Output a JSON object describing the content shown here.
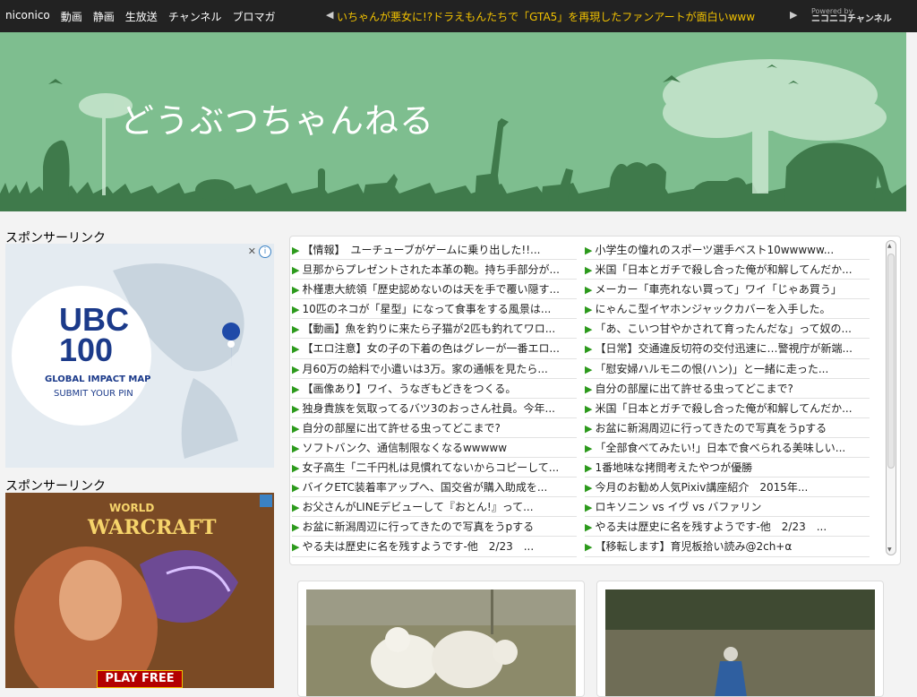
{
  "topbar": {
    "nav": [
      "niconico",
      "動画",
      "静画",
      "生放送",
      "チャンネル",
      "ブロマガ"
    ],
    "ticker": "いちゃんが悪女に!?ドラえもんたちで「GTA5」を再現したファンアートが面白いwww",
    "powered_small": "Powered by",
    "powered_brand": "ニコニコチャンネル"
  },
  "banner": {
    "title": "どうぶつちゃんねる"
  },
  "sidebar": {
    "sponsor_label_1": "スポンサーリンク",
    "sponsor_label_2": "スポンサーリンク",
    "ad1": {
      "big1": "UBC",
      "big2": "100",
      "line1": "GLOBAL IMPACT MAP",
      "line2": "SUBMIT YOUR PIN"
    },
    "ad2": {
      "line1": "WORLD",
      "line2": "WARCRAFT",
      "button": "PLAY FREE"
    }
  },
  "links": {
    "left": [
      "【情報】　ユーチューブがゲームに乗り出した!!...",
      "旦那からプレゼントされた本革の鞄。持ち手部分が...",
      "朴槿恵大統領「歴史認めないのは天を手で覆い隠す...",
      "10匹のネコが「星型」になって食事をする風景は...",
      "【動画】魚を釣りに来たら子猫が2匹も釣れてワロ...",
      "【エロ注意】女の子の下着の色はグレーが一番エロ...",
      "月60万の給料で小遣いは3万。家の通帳を見たら...",
      "【画像あり】ワイ、うなぎもどきをつくる。",
      "独身貴族を気取ってるバツ3のおっさん社員。今年...",
      "自分の部屋に出て許せる虫ってどこまで?",
      "ソフトバンク、通信制限なくなるwwwww",
      "女子高生「二千円札は見慣れてないからコピーして...",
      "バイクETC装着率アップへ、国交省が購入助成を...",
      "お父さんがLINEデビューして『おとん!』って...",
      "お盆に新潟周辺に行ってきたので写真をうpする",
      "やる夫は歴史に名を残すようです-他　2/23　..."
    ],
    "right": [
      "小学生の憧れのスポーツ選手ベスト10wwwww...",
      "米国「日本とガチで殺し合った俺が和解してんだか...",
      "メーカー「車売れない買って」ワイ「じゃあ買う」",
      "にゃんこ型イヤホンジャックカバーを入手した。",
      "「あ、こいつ甘やかされて育ったんだな」って奴の...",
      "【日常】交通違反切符の交付迅速に…警視庁が新端...",
      "「慰安婦ハルモニの恨(ハン)」と一緒に走った...",
      "自分の部屋に出て許せる虫ってどこまで?",
      "米国「日本とガチで殺し合った俺が和解してんだか...",
      "お盆に新潟周辺に行ってきたので写真をうpする",
      "「全部食べてみたい!」日本で食べられる美味しい...",
      "1番地味な拷問考えたやつが優勝",
      "今月のお勧め人気Pixiv講座紹介　2015年...",
      "ロキソニン vs イヴ vs バファリン",
      "やる夫は歴史に名を残すようです-他　2/23　...",
      "【移転します】育児板拾い読み@2ch+α"
    ]
  },
  "colors": {
    "banner": "#7ebe8f",
    "silhouette": "#3f7a4b",
    "ticker": "#f2c200",
    "link_arrow": "#2c9a1c"
  }
}
